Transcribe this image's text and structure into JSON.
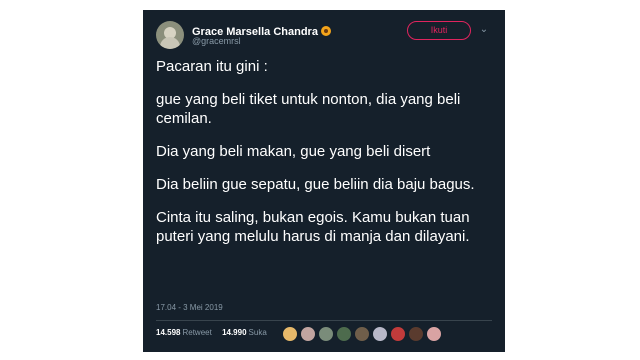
{
  "tweet": {
    "display_name": "Grace Marsella Chandra",
    "handle": "@gracemrsl",
    "follow_label": "Ikuti",
    "paragraphs": [
      "Pacaran itu gini :",
      " gue yang beli tiket untuk nonton, dia yang beli cemilan.",
      "Dia yang beli makan, gue yang beli disert",
      "Dia beliin gue sepatu, gue beliin dia baju bagus.",
      "Cinta itu saling, bukan egois. Kamu bukan tuan puteri yang melulu harus di manja dan dilayani."
    ],
    "timestamp": "17.04 - 3 Mei 2019",
    "retweet_count": "14.598",
    "retweet_label": "Retweet",
    "like_count": "14.990",
    "like_label": "Suka",
    "liker_colors": [
      "#e7b96a",
      "#c2a5a0",
      "#7a8c7a",
      "#4d6b4d",
      "#6f5e4a",
      "#b8b8c8",
      "#c23b3b",
      "#5a3b2e",
      "#d9a3a3"
    ]
  },
  "colors": {
    "background": "#15202b",
    "accent": "#e0245e",
    "secondary_text": "#8899a6"
  },
  "icons": {
    "flower": "sunflower-icon",
    "chevron": "chevron-down-icon"
  }
}
